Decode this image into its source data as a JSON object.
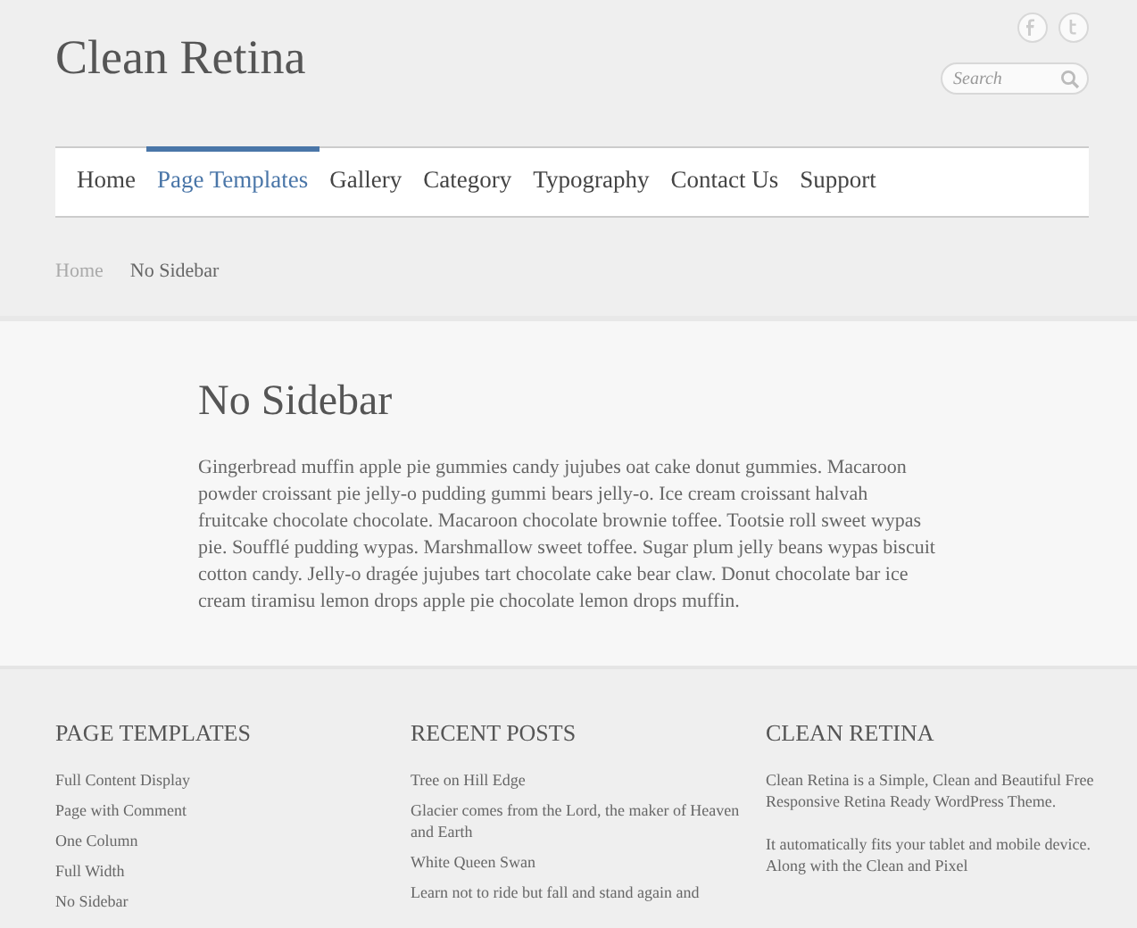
{
  "site_title": "Clean Retina",
  "social": [
    {
      "kind": "facebook"
    },
    {
      "kind": "twitter"
    }
  ],
  "search": {
    "placeholder": "Search"
  },
  "nav": [
    {
      "label": "Home",
      "selected": false
    },
    {
      "label": "Page Templates",
      "selected": true
    },
    {
      "label": "Gallery",
      "selected": false
    },
    {
      "label": "Category",
      "selected": false
    },
    {
      "label": "Typography",
      "selected": false
    },
    {
      "label": "Contact Us",
      "selected": false
    },
    {
      "label": "Support",
      "selected": false
    }
  ],
  "breadcrumb": [
    "Home",
    "No Sidebar"
  ],
  "page": {
    "title": "No Sidebar",
    "body": "Gingerbread muffin apple pie gummies candy jujubes oat cake donut gummies. Macaroon powder croissant pie jelly-o pudding gummi bears jelly-o. Ice cream croissant halvah fruitcake chocolate chocolate. Macaroon chocolate brownie toffee. Tootsie roll sweet wypas pie. Soufflé pudding wypas. Marshmallow sweet toffee. Sugar plum jelly beans wypas biscuit cotton candy. Jelly-o dragée jujubes tart chocolate cake bear claw. Donut chocolate bar ice cream tiramisu lemon drops apple pie chocolate lemon drops muffin."
  },
  "footer": [
    {
      "kind": "links",
      "title": "PAGE TEMPLATES",
      "items": [
        "Full Content Display",
        "Page with Comment",
        "One Column",
        "Full Width",
        "No Sidebar"
      ]
    },
    {
      "kind": "links",
      "title": "RECENT POSTS",
      "items": [
        "Tree on Hill Edge",
        "Glacier comes from the Lord, the maker of Heaven and Earth",
        "White Queen Swan",
        "Learn not to ride but fall and stand again and"
      ]
    },
    {
      "kind": "text",
      "title": "CLEAN RETINA",
      "items": [
        "Clean Retina is a Simple, Clean and Beautiful Free Responsive Retina Ready WordPress Theme.",
        "It automatically fits your tablet and mobile device. Along with the Clean and Pixel"
      ]
    }
  ]
}
